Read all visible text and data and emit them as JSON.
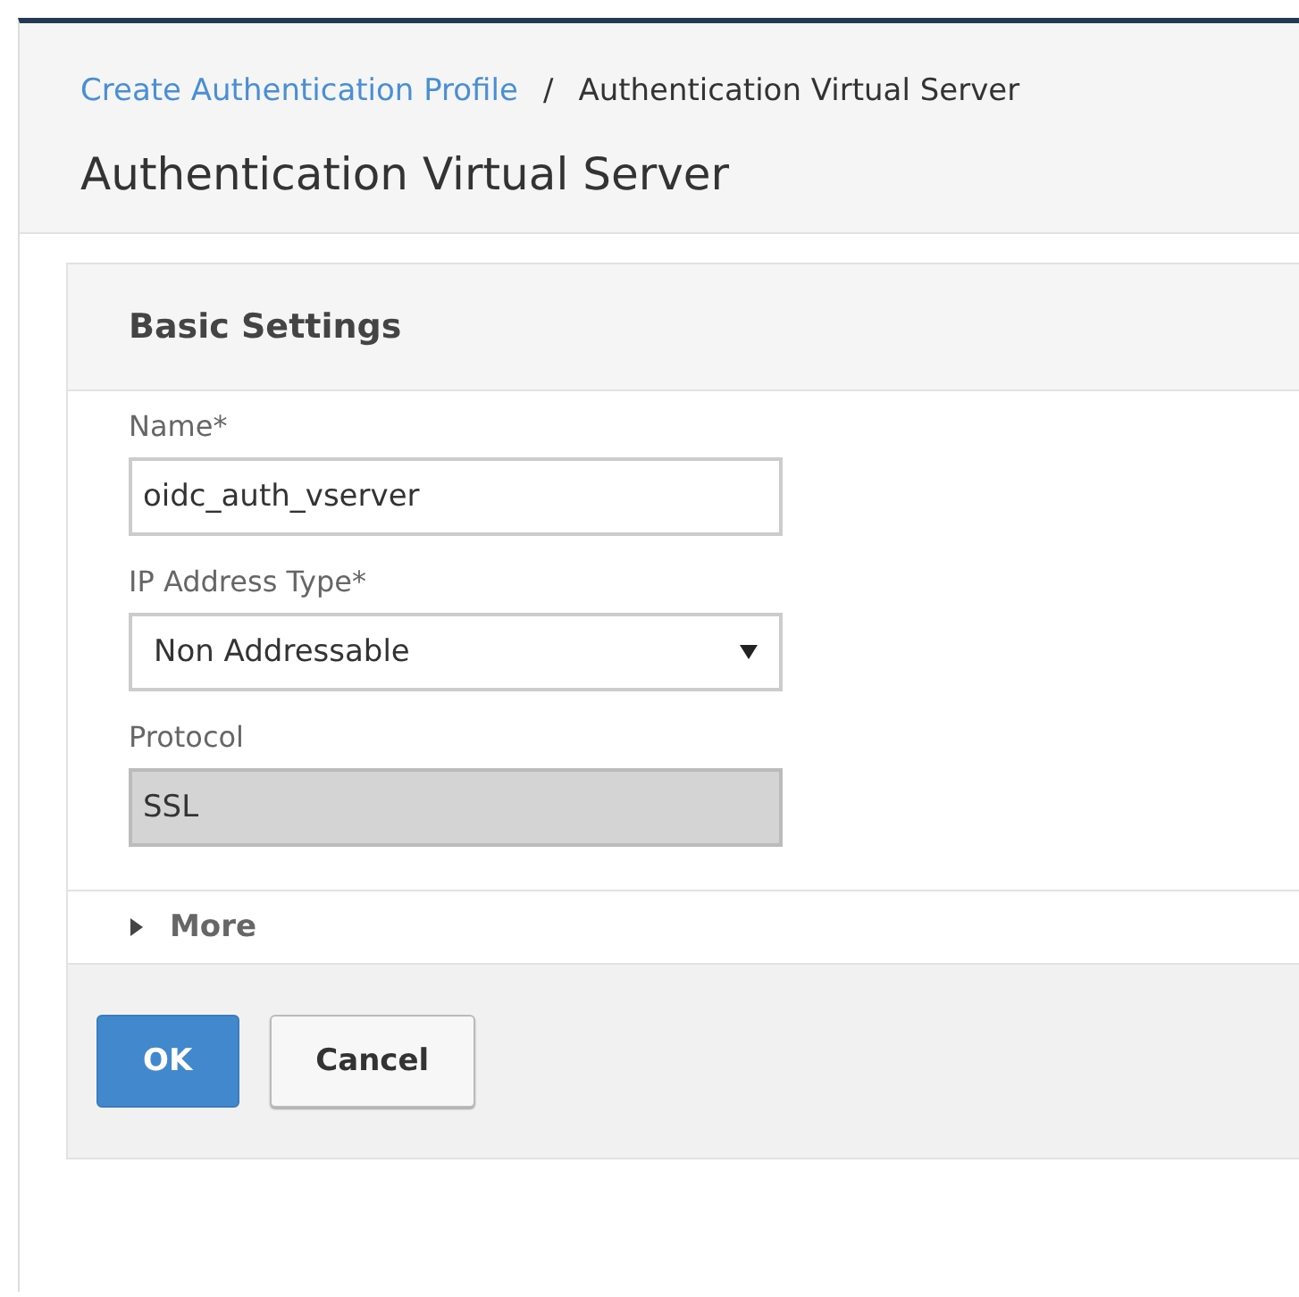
{
  "breadcrumb": {
    "link": "Create Authentication Profile",
    "separator": "/",
    "current": "Authentication Virtual Server"
  },
  "title": "Authentication Virtual Server",
  "panel": {
    "title": "Basic Settings",
    "fields": [
      {
        "label": "Name*",
        "kind": "text",
        "value": "oidc_auth_vserver"
      },
      {
        "label": "IP Address Type*",
        "kind": "select",
        "value": "Non Addressable"
      },
      {
        "label": "Protocol",
        "kind": "readonly",
        "value": "SSL"
      }
    ],
    "more": {
      "label": "More",
      "expanded": false
    },
    "buttons": [
      {
        "label": "OK",
        "kind": "primary"
      },
      {
        "label": "Cancel",
        "kind": "secondary"
      }
    ]
  }
}
